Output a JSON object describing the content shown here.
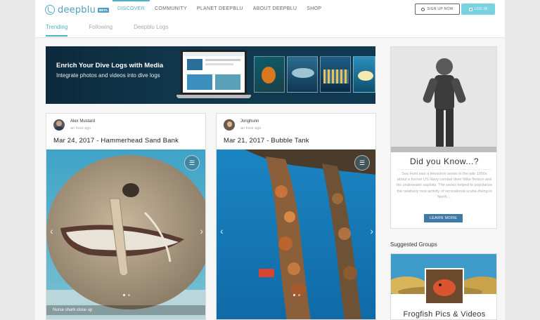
{
  "brand": {
    "name": "deepblu",
    "badge": "BETA"
  },
  "nav": {
    "items": [
      "DISCOVER",
      "COMMUNITY",
      "PLANET DEEPBLU",
      "ABOUT DEEPBLU",
      "SHOP"
    ],
    "active": "DISCOVER"
  },
  "auth": {
    "signup": "SIGN UP NOW",
    "login": "LOG IN"
  },
  "tabs": [
    "Trending",
    "Following",
    "Deepblu Logs"
  ],
  "banner": {
    "title": "Enrich Your Dive Logs with Media",
    "subtitle": "Integrate photos and videos into dive logs"
  },
  "posts": [
    {
      "author": "Alex Mustard",
      "time": "an hour ago",
      "title": "Mar 24, 2017 - Hammerhead Sand Bank",
      "caption": "Nurse shark close up"
    },
    {
      "author": "Jonghunn",
      "time": "an hour ago",
      "title": "Mar 21, 2017 - Bubble Tank",
      "caption": ""
    }
  ],
  "did_you_know": {
    "title": "Did you Know...?",
    "text": "Sea Hunt was a television series in the late 1950s about a former US Navy combat diver Mike Nelson and his underwater exploits. The series helped to popularize the relatively new activity of recreational scuba diving in North ...",
    "button": "LEARN MORE"
  },
  "suggested_groups": {
    "label": "Suggested Groups",
    "groups": [
      {
        "title": "Frogfish Pics & Videos"
      }
    ]
  },
  "colors": {
    "accent": "#4fb3c9",
    "login_bg": "#78d3df",
    "learn_more_bg": "#3f79a8",
    "banner_bg": "#11364b"
  },
  "icons": [
    "deepblu-logo-icon",
    "user-icon",
    "lock-icon",
    "dive-log-book-icon",
    "chevron-left-icon",
    "chevron-right-icon"
  ]
}
